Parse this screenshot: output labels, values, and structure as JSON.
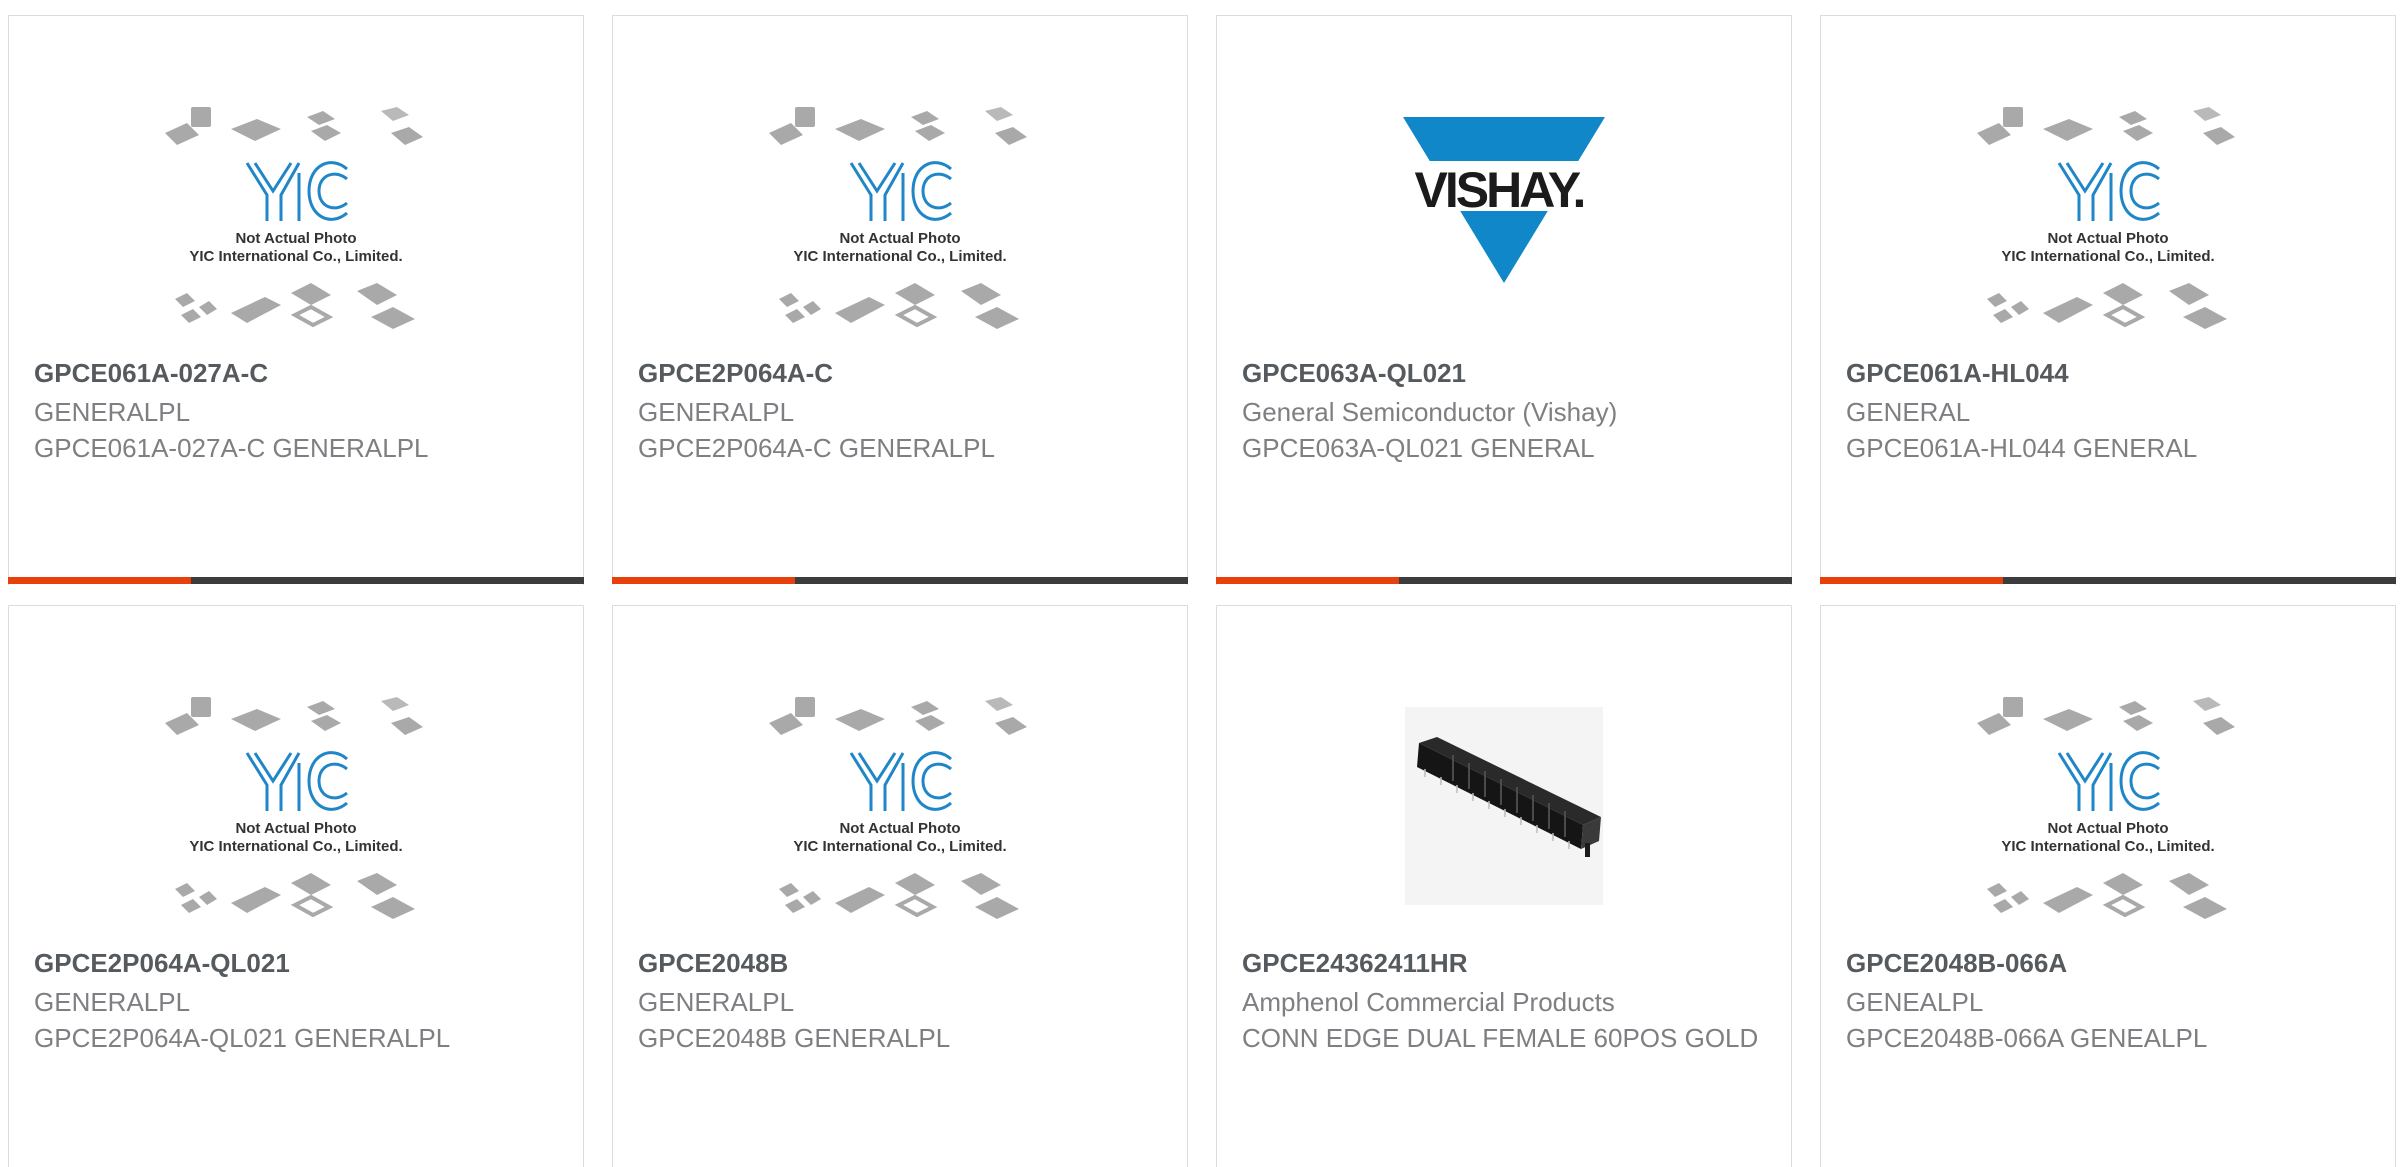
{
  "products": [
    {
      "image": "yic-placeholder",
      "placeholder_line1": "Not Actual Photo",
      "placeholder_line2": "YIC International Co., Limited.",
      "part_number": "GPCE061A-027A-C",
      "manufacturer": "GENERALPL",
      "description": "GPCE061A-027A-C GENERALPL"
    },
    {
      "image": "yic-placeholder",
      "placeholder_line1": "Not Actual Photo",
      "placeholder_line2": "YIC International Co., Limited.",
      "part_number": "GPCE2P064A-C",
      "manufacturer": "GENERALPL",
      "description": "GPCE2P064A-C GENERALPL"
    },
    {
      "image": "vishay-logo",
      "logo_text": "VISHAY.",
      "part_number": "GPCE063A-QL021",
      "manufacturer": "General Semiconductor (Vishay)",
      "description": "GPCE063A-QL021 GENERAL"
    },
    {
      "image": "yic-placeholder",
      "placeholder_line1": "Not Actual Photo",
      "placeholder_line2": "YIC International Co., Limited.",
      "part_number": "GPCE061A-HL044",
      "manufacturer": "GENERAL",
      "description": "GPCE061A-HL044 GENERAL"
    },
    {
      "image": "yic-placeholder",
      "placeholder_line1": "Not Actual Photo",
      "placeholder_line2": "YIC International Co., Limited.",
      "part_number": "GPCE2P064A-QL021",
      "manufacturer": "GENERALPL",
      "description": "GPCE2P064A-QL021 GENERALPL"
    },
    {
      "image": "yic-placeholder",
      "placeholder_line1": "Not Actual Photo",
      "placeholder_line2": "YIC International Co., Limited.",
      "part_number": "GPCE2048B",
      "manufacturer": "GENERALPL",
      "description": "GPCE2048B GENERALPL"
    },
    {
      "image": "edge-connector-photo",
      "part_number": "GPCE24362411HR",
      "manufacturer": "Amphenol Commercial Products",
      "description": "CONN EDGE DUAL FEMALE 60POS GOLD"
    },
    {
      "image": "yic-placeholder",
      "placeholder_line1": "Not Actual Photo",
      "placeholder_line2": "YIC International Co., Limited.",
      "part_number": "GPCE2048B-066A",
      "manufacturer": "GENEALPL",
      "description": "GPCE2048B-066A GENEALPL"
    }
  ],
  "colors": {
    "accent": "#e8400c",
    "bar": "#3a3c3e",
    "yic_blue": "#1f86c8",
    "vishay_blue": "#0f87c9",
    "part_text": "#555a5e",
    "meta_text": "#7d7f82"
  }
}
